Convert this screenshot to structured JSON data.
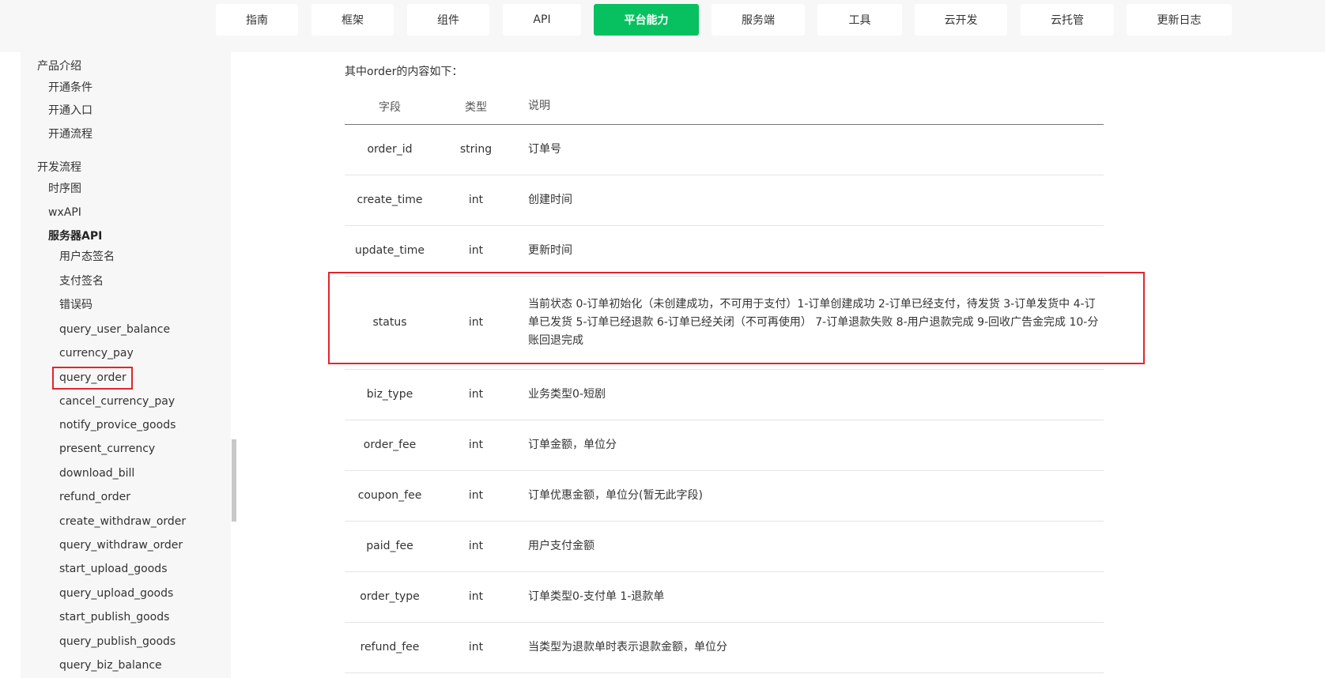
{
  "nav": {
    "tabs": [
      {
        "label": "指南"
      },
      {
        "label": "框架"
      },
      {
        "label": "组件"
      },
      {
        "label": "API"
      },
      {
        "label": "平台能力"
      },
      {
        "label": "服务端"
      },
      {
        "label": "工具"
      },
      {
        "label": "云开发"
      },
      {
        "label": "云托管"
      },
      {
        "label": "更新日志"
      }
    ],
    "active": "平台能力",
    "accent_color": "#07c160"
  },
  "sidebar": {
    "items": [
      {
        "label": "产品介绍"
      },
      {
        "label": "开通条件"
      },
      {
        "label": "开通入口"
      },
      {
        "label": "开通流程"
      },
      {
        "label": "开发流程"
      },
      {
        "label": "时序图"
      },
      {
        "label": "wxAPI"
      },
      {
        "label": "服务器API"
      },
      {
        "label": "用户态签名"
      },
      {
        "label": "支付签名"
      },
      {
        "label": "错误码"
      },
      {
        "label": "query_user_balance"
      },
      {
        "label": "currency_pay"
      },
      {
        "label": "query_order"
      },
      {
        "label": "cancel_currency_pay"
      },
      {
        "label": "notify_provice_goods"
      },
      {
        "label": "present_currency"
      },
      {
        "label": "download_bill"
      },
      {
        "label": "refund_order"
      },
      {
        "label": "create_withdraw_order"
      },
      {
        "label": "query_withdraw_order"
      },
      {
        "label": "start_upload_goods"
      },
      {
        "label": "query_upload_goods"
      },
      {
        "label": "start_publish_goods"
      },
      {
        "label": "query_publish_goods"
      },
      {
        "label": "query_biz_balance"
      }
    ],
    "highlighted": "query_order",
    "highlight_color": "#e0262e"
  },
  "content": {
    "intro": "其中order的内容如下：",
    "table": {
      "headers": {
        "field": "字段",
        "type": "类型",
        "desc": "说明"
      },
      "rows": [
        {
          "field": "order_id",
          "type": "string",
          "desc": "订单号"
        },
        {
          "field": "create_time",
          "type": "int",
          "desc": "创建时间"
        },
        {
          "field": "update_time",
          "type": "int",
          "desc": "更新时间"
        },
        {
          "field": "status",
          "type": "int",
          "desc": "当前状态 0-订单初始化（未创建成功，不可用于支付）1-订单创建成功 2-订单已经支付，待发货 3-订单发货中 4-订单已发货 5-订单已经退款 6-订单已经关闭（不可再使用） 7-订单退款失败 8-用户退款完成 9-回收广告金完成 10-分账回退完成"
        },
        {
          "field": "biz_type",
          "type": "int",
          "desc": "业务类型0-短剧"
        },
        {
          "field": "order_fee",
          "type": "int",
          "desc": "订单金额，单位分"
        },
        {
          "field": "coupon_fee",
          "type": "int",
          "desc": "订单优惠金额，单位分(暂无此字段)"
        },
        {
          "field": "paid_fee",
          "type": "int",
          "desc": "用户支付金额"
        },
        {
          "field": "order_type",
          "type": "int",
          "desc": "订单类型0-支付单 1-退款单"
        },
        {
          "field": "refund_fee",
          "type": "int",
          "desc": "当类型为退款单时表示退款金额，单位分"
        }
      ]
    }
  }
}
